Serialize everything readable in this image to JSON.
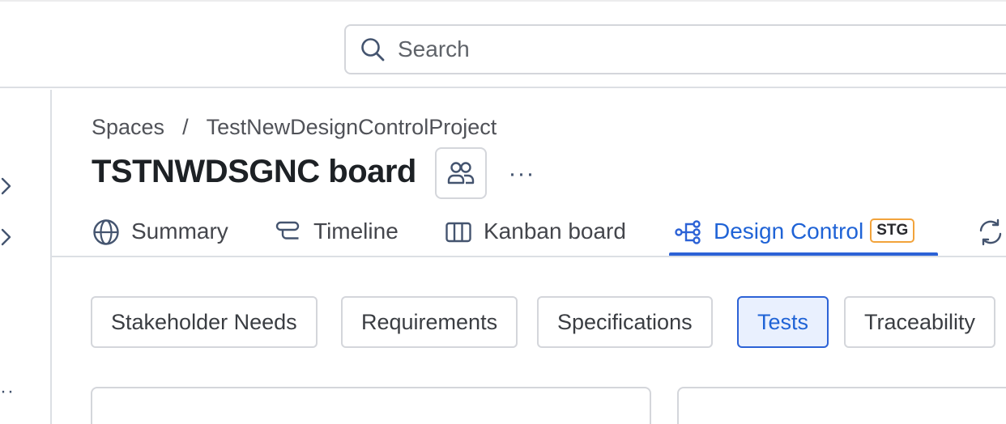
{
  "search": {
    "placeholder": "Search"
  },
  "breadcrumb": {
    "root": "Spaces",
    "separator": "/",
    "project": "TestNewDesignControlProject"
  },
  "header": {
    "title": "TSTNWDSGNC board",
    "more_label": "···"
  },
  "tabs": [
    {
      "label": "Summary",
      "icon": "globe-icon"
    },
    {
      "label": "Timeline",
      "icon": "timeline-icon"
    },
    {
      "label": "Kanban board",
      "icon": "board-columns-icon"
    },
    {
      "label": "Design Control",
      "icon": "hierarchy-icon",
      "badge": "STG",
      "active": true
    },
    {
      "label": "",
      "icon": "refresh-icon"
    }
  ],
  "subtabs": [
    {
      "label": "Stakeholder Needs"
    },
    {
      "label": "Requirements"
    },
    {
      "label": "Specifications"
    },
    {
      "label": "Tests",
      "active": true
    },
    {
      "label": "Traceability"
    }
  ],
  "sidebar": {
    "more_label": "··"
  },
  "colors": {
    "accent": "#2c62d6",
    "active_bg": "#e9f0fe",
    "badge_border": "#f2a33b",
    "border": "#d4d6db",
    "text": "#292a2e"
  }
}
